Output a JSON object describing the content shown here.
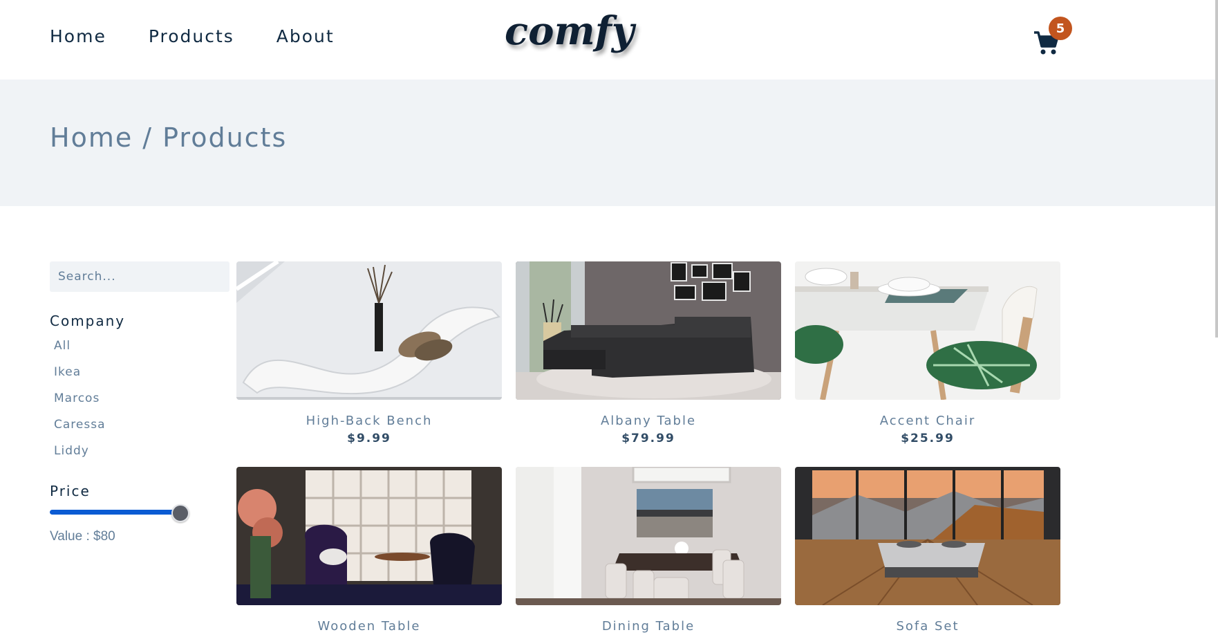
{
  "nav": {
    "links": [
      "Home",
      "Products",
      "About"
    ],
    "logo": "comfy",
    "cart_count": "5"
  },
  "hero": {
    "breadcrumb": "Home / Products"
  },
  "filters": {
    "search_placeholder": "Search...",
    "company_heading": "Company",
    "companies": [
      "All",
      "Ikea",
      "Marcos",
      "Caressa",
      "Liddy"
    ],
    "price_heading": "Price",
    "price_value_text": "Value : $80",
    "price_slider_fraction": 1.0
  },
  "products": [
    {
      "name": "High-Back Bench",
      "price": "$9.99"
    },
    {
      "name": "Albany Table",
      "price": "$79.99"
    },
    {
      "name": "Accent Chair",
      "price": "$25.99"
    },
    {
      "name": "Wooden Table",
      "price": ""
    },
    {
      "name": "Dining Table",
      "price": ""
    },
    {
      "name": "Sofa Set",
      "price": ""
    }
  ],
  "colors": {
    "accent": "#c2551e",
    "slider": "#0b5bd3",
    "text_dark": "#102a42",
    "text_muted": "#617d98"
  }
}
